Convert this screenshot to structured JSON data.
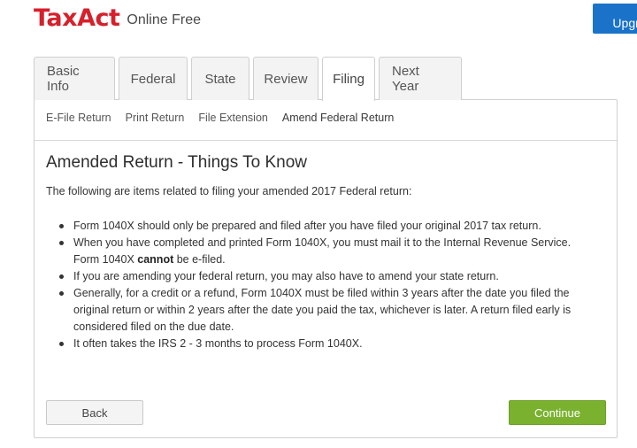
{
  "header": {
    "logo_text": "TaxAct",
    "product_label": "Online Free",
    "upgrade_label": "Upgra",
    "brand_color": "#d6202b",
    "upgrade_color": "#1a73c9"
  },
  "tabs": [
    {
      "label": "Basic Info",
      "active": false
    },
    {
      "label": "Federal",
      "active": false
    },
    {
      "label": "State",
      "active": false
    },
    {
      "label": "Review",
      "active": false
    },
    {
      "label": "Filing",
      "active": true
    },
    {
      "label": "Next Year",
      "active": false
    }
  ],
  "subnav": [
    {
      "label": "E-File Return",
      "active": false
    },
    {
      "label": "Print Return",
      "active": false
    },
    {
      "label": "File Extension",
      "active": false
    },
    {
      "label": "Amend Federal Return",
      "active": true
    }
  ],
  "content": {
    "title": "Amended Return - Things To Know",
    "intro": "The following are items related to filing your amended 2017 Federal return:",
    "bullets": {
      "b1": "Form 1040X should only be prepared and filed after you have filed your original 2017 tax return.",
      "b2_line1": "When you have completed and printed Form 1040X, you must mail it to the Internal Revenue Service.",
      "b2_pre": "Form 1040X ",
      "b2_bold": "cannot",
      "b2_post": " be e-filed.",
      "b3": "If you are amending your federal return, you may also have to amend your state return.",
      "b4_line1": "Generally, for a credit or a refund, Form 1040X must be filed within 3 years after the date you filed the",
      "b4_line2": "original return or within 2 years after the date you paid the tax, whichever is later. A return filed early is",
      "b4_line3": "considered filed on the due date.",
      "b5": "It often takes the IRS 2 - 3 months to process Form 1040X."
    }
  },
  "actions": {
    "back_label": "Back",
    "continue_label": "Continue",
    "continue_color": "#7ab22f"
  }
}
